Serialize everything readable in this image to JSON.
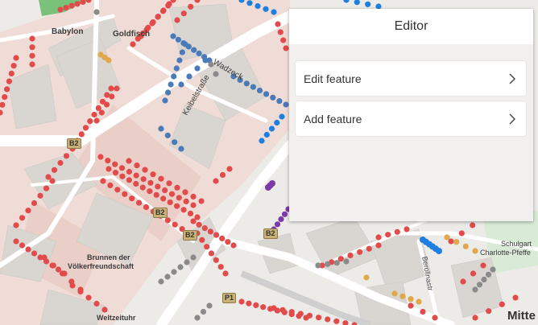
{
  "map": {
    "labels": {
      "babylon": "Babylon",
      "goldfisch": "Goldfisch",
      "keibel": "Keibelstraße",
      "wadzeck": "Wadzeck",
      "brunnen1": "Brunnen der",
      "brunnen2": "Völkerfreundschaft",
      "weltzeituhr": "Weltzeituhr",
      "berolinastr": "Berolinastr",
      "schulgarten1": "Schulgart",
      "schulgarten2": "Charlotte-Pfeffe",
      "mitte": "Mitte"
    },
    "shields": {
      "b2a": "B2",
      "b2b": "B2",
      "b2c": "B2",
      "b2d": "B2",
      "p1": "P1"
    }
  },
  "editor": {
    "title": "Editor",
    "items": [
      {
        "label": "Edit feature"
      },
      {
        "label": "Add feature"
      }
    ]
  },
  "colors": {
    "red_dots": "#e24b4b",
    "blue_dots": "#4a7ab8",
    "bright_blue_dots": "#1f7fe0",
    "gray_dots": "#8a8a8a",
    "orange_dots": "#e0a84a",
    "purple_dots": "#7c3aa8"
  }
}
